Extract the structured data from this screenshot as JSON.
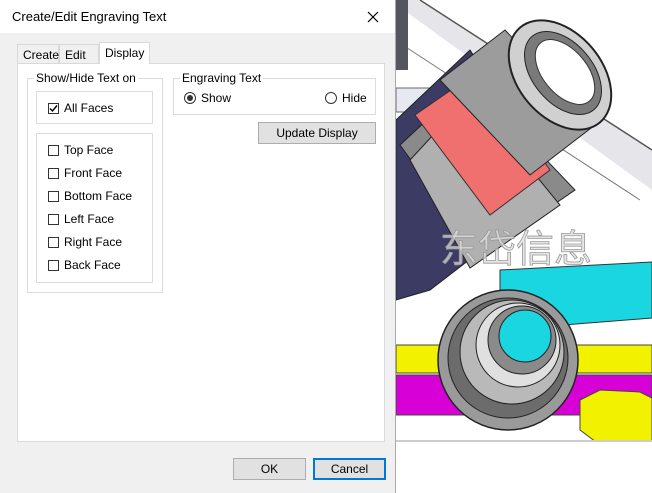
{
  "dialog": {
    "title": "Create/Edit Engraving Text"
  },
  "tabs": [
    {
      "label": "Create"
    },
    {
      "label": "Edit"
    },
    {
      "label": "Display"
    }
  ],
  "show_hide_group": {
    "legend": "Show/Hide Text on",
    "all_faces": {
      "label": "All Faces",
      "checked": true
    },
    "faces": [
      {
        "label": "Top Face",
        "checked": false
      },
      {
        "label": "Front Face",
        "checked": false
      },
      {
        "label": "Bottom Face",
        "checked": false
      },
      {
        "label": "Left Face",
        "checked": false
      },
      {
        "label": "Right Face",
        "checked": false
      },
      {
        "label": "Back Face",
        "checked": false
      }
    ]
  },
  "engraving_text_group": {
    "legend": "Engraving Text",
    "options": [
      {
        "label": "Show",
        "selected": true
      },
      {
        "label": "Hide",
        "selected": false
      }
    ]
  },
  "buttons": {
    "update_display": "Update Display",
    "ok": "OK",
    "cancel": "Cancel"
  },
  "background": {
    "watermark": "东岱信息"
  },
  "colors": {
    "accent": "#0078d7",
    "cyan_part": "#19d6e0",
    "magenta_part": "#d700d7",
    "yellow_part": "#f2f200",
    "red_band": "#f07070"
  }
}
